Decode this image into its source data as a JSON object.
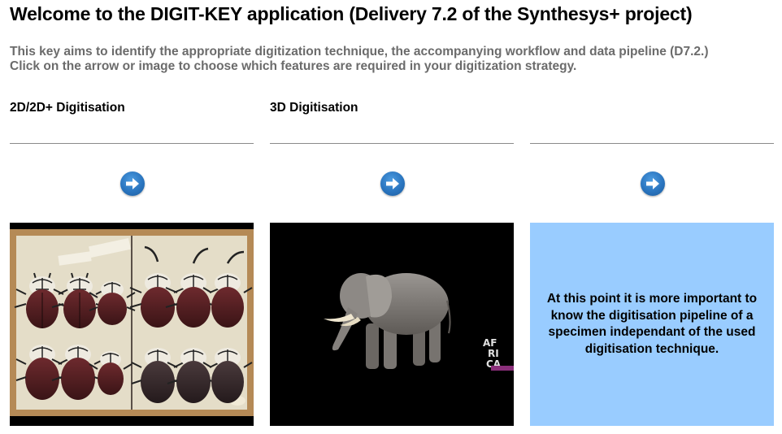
{
  "header": {
    "title": "Welcome to the DIGIT-KEY application (Delivery 7.2 of the Synthesys+ project)",
    "intro_line1": "This key aims to identify the appropriate digitization technique, the accompanying workflow and data pipeline (D7.2.)",
    "intro_line2": "Click on the arrow or image to choose which features are required in your digitization strategy."
  },
  "columns": [
    {
      "title": "2D/2D+ Digitisation",
      "image": "beetle-specimen-drawer-photo"
    },
    {
      "title": "3D Digitisation",
      "image": "elephant-3d-model-render",
      "watermark": [
        "AF",
        "RI",
        "CA"
      ]
    },
    {
      "title": "",
      "text": "At this point it is more important to know the digitisation pipeline of a specimen independant of the used digitisation technique."
    }
  ],
  "icons": {
    "arrow": "arrow-right-circle-icon"
  },
  "colors": {
    "arrow_button": "#2a75bf",
    "info_tile": "#99ccff",
    "intro_text": "#6b6b6b",
    "divider": "#8a8a8a"
  }
}
